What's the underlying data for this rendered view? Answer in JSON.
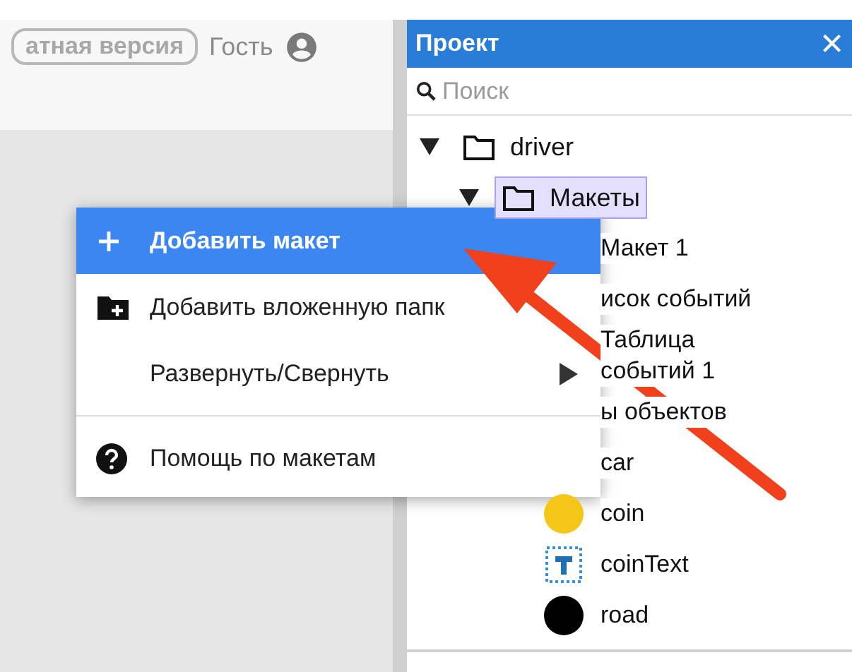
{
  "header": {
    "edition_badge": "атная версия",
    "user": "Гость"
  },
  "panel": {
    "title": "Проект",
    "close": "×",
    "search": {
      "placeholder": "Поиск"
    },
    "tree": [
      {
        "label": "driver",
        "expanded": true,
        "selected": false,
        "children": [
          {
            "label": "Макеты",
            "expanded": true,
            "selected": true,
            "children": [
              {
                "label": "Макет 1",
                "kind": "none"
              },
              {
                "label": "исок событий",
                "kind": "none"
              },
              {
                "label": "Таблица событий 1",
                "kind": "none"
              },
              {
                "label": "ы объектов",
                "kind": "none"
              },
              {
                "label": "car",
                "kind": "none"
              },
              {
                "label": "coin",
                "kind": "circle",
                "color": "#f5c518"
              },
              {
                "label": "coinText",
                "kind": "text"
              },
              {
                "label": "road",
                "kind": "circle",
                "color": "#000000"
              }
            ]
          }
        ]
      }
    ]
  },
  "context_menu": [
    {
      "kind": "add",
      "label": "Добавить макет",
      "selected": true
    },
    {
      "kind": "add-folder",
      "label": "Добавить вложенную папк",
      "selected": false
    },
    {
      "kind": "submenu",
      "label": "Развернуть/Свернуть",
      "selected": false
    },
    {
      "kind": "separator"
    },
    {
      "kind": "help",
      "label": "Помощь по макетам",
      "selected": false
    }
  ]
}
